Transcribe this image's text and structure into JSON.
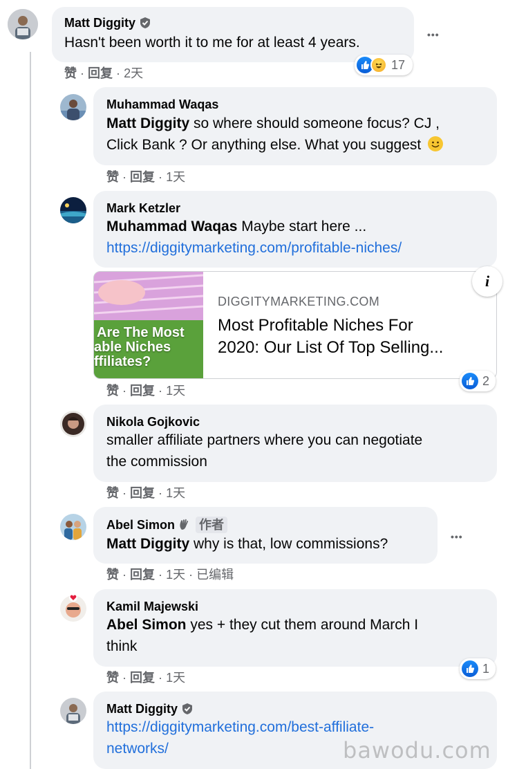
{
  "comments": [
    {
      "author": "Matt Diggity",
      "text": "Hasn't been worth it to me for at least 4 years.",
      "like": "赞",
      "reply": "回复",
      "time": "2天",
      "reaction_count": "17"
    },
    {
      "author": "Muhammad Waqas",
      "mention": "Matt Diggity",
      "text_line1": " so where should someone focus? CJ ,",
      "text_line2": "Click Bank ? Or anything else. What you suggest",
      "emoji": "🙂",
      "like": "赞",
      "reply": "回复",
      "time": "1天"
    },
    {
      "author": "Mark Ketzler",
      "mention": "Muhammad Waqas",
      "text": " Maybe start here ...",
      "link": "https://diggitymarketing.com/profitable-niches/",
      "preview": {
        "domain": "DIGGITYMARKETING.COM",
        "title_line1": "Most Profitable Niches For",
        "title_line2": "2020: Our List Of Top Selling...",
        "thumb_line1": "Are The Most",
        "thumb_line2": "able Niches",
        "thumb_line3": "ffiliates?",
        "info_glyph": "i"
      },
      "reaction_count": "2",
      "like": "赞",
      "reply": "回复",
      "time": "1天"
    },
    {
      "author": "Nikola Gojkovic",
      "text_line1": "smaller affiliate partners where you can negotiate",
      "text_line2": "the commission",
      "like": "赞",
      "reply": "回复",
      "time": "1天"
    },
    {
      "author": "Abel Simon",
      "badge": "作者",
      "mention": "Matt Diggity",
      "text": " why is that, low commissions?",
      "like": "赞",
      "reply": "回复",
      "time": "1天",
      "edited": "已编辑"
    },
    {
      "author": "Kamil Majewski",
      "mention": "Abel Simon",
      "text_line1": " yes + they cut them around March I",
      "text_line2": "think",
      "reaction_count": "1",
      "like": "赞",
      "reply": "回复",
      "time": "1天"
    },
    {
      "author": "Matt Diggity",
      "link_line1": "https://diggitymarketing.com/best-affiliate-",
      "link_line2": "networks/"
    }
  ],
  "more_options": "•••",
  "sep": "·",
  "watermark": "bawodu.com",
  "colors": {
    "link": "#216fdb",
    "bubble": "#f0f2f5",
    "meta": "#65676b",
    "like": "#1877f2"
  }
}
